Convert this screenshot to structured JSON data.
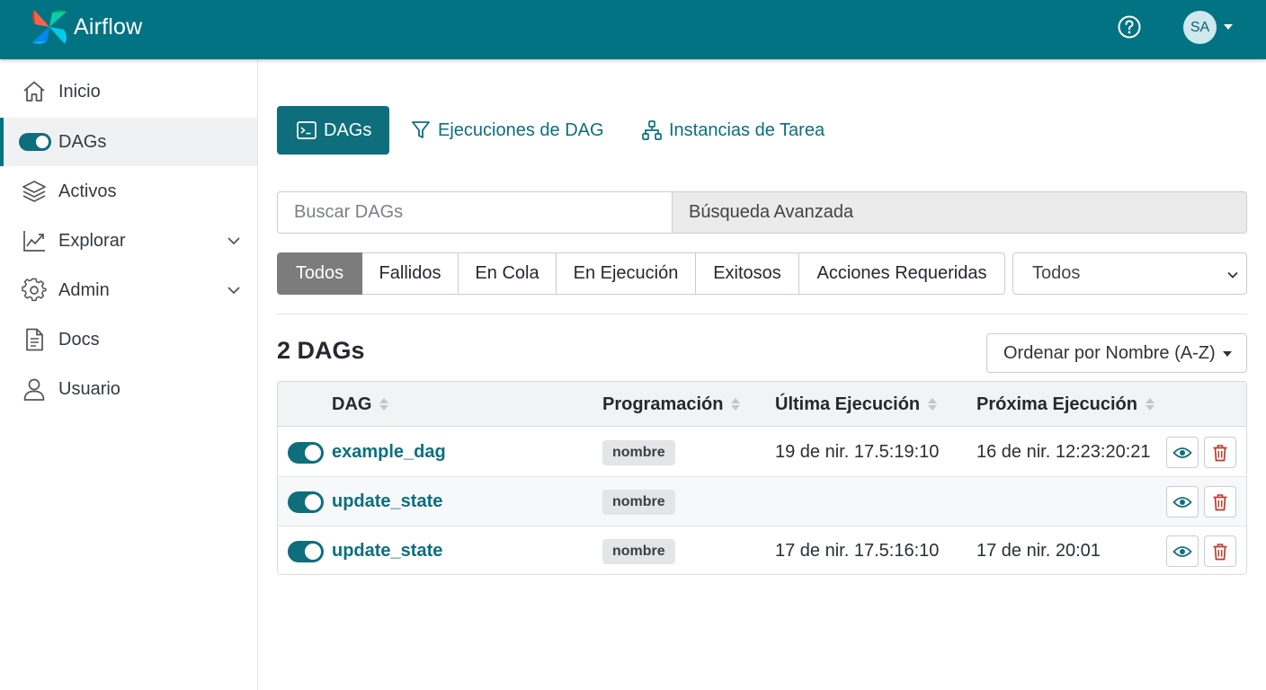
{
  "app": {
    "title": "Airflow",
    "user_initials": "SA"
  },
  "colors": {
    "header": "#017383",
    "accent": "#0e6e7b",
    "danger": "#c0392b"
  },
  "sidebar": {
    "items": [
      {
        "label": "Inicio",
        "icon": "home-icon"
      },
      {
        "label": "DAGs",
        "icon": "toggle-icon",
        "active": true
      },
      {
        "label": "Activos",
        "icon": "layers-icon"
      },
      {
        "label": "Explorar",
        "icon": "chart-line-icon",
        "expandable": true
      },
      {
        "label": "Admin",
        "icon": "gear-icon",
        "expandable": true
      },
      {
        "label": "Docs",
        "icon": "document-icon"
      },
      {
        "label": "Usuario",
        "icon": "user-icon"
      }
    ]
  },
  "tabs": [
    {
      "label": "DAGs",
      "icon": "terminal-icon",
      "active": true
    },
    {
      "label": "Ejecuciones de DAG",
      "icon": "filter-icon"
    },
    {
      "label": "Instancias de Tarea",
      "icon": "hierarchy-icon"
    }
  ],
  "search": {
    "placeholder": "Buscar DAGs",
    "advanced_label": "Búsqueda Avanzada"
  },
  "filters": {
    "buttons": [
      "Todos",
      "Fallidos",
      "En Cola",
      "En Ejecución",
      "Exitosos",
      "Acciones Requeridas"
    ],
    "active": "Todos",
    "select_value": "Todos"
  },
  "list": {
    "count_title": "2 DAGs",
    "sort_label": "Ordenar por Nombre (A-Z)"
  },
  "table": {
    "headers": [
      "DAG",
      "Programación",
      "Última Ejecución",
      "Próxima Ejecución"
    ],
    "rows": [
      {
        "name": "example_dag",
        "schedule": "nombre",
        "last_run": "19 de nir. 17.5:19:10",
        "next_run": "16 de nir. 12:23:20:21"
      },
      {
        "name": "update_state",
        "schedule": "nombre",
        "last_run": "",
        "next_run": ""
      },
      {
        "name": "update_state",
        "schedule": "nombre",
        "last_run": "17 de nir. 17.5:16:10",
        "next_run": "17 de nir. 20:01"
      }
    ]
  }
}
